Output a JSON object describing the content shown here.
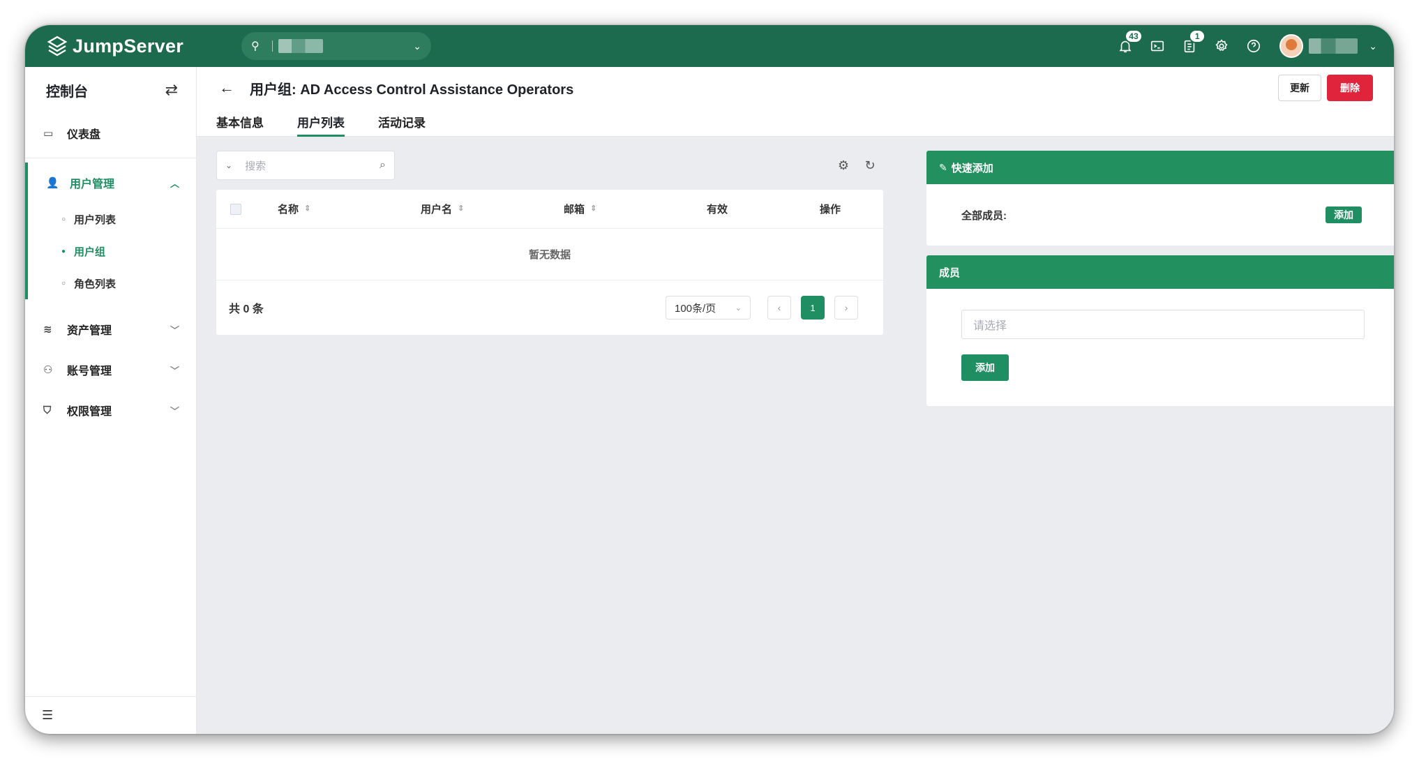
{
  "app": {
    "name": "JumpServer",
    "org_placeholder": ""
  },
  "topbar": {
    "notifications_count": "43",
    "tasks_count": "1"
  },
  "sidebar": {
    "title": "控制台",
    "items": [
      {
        "label": "仪表盘"
      },
      {
        "label": "用户管理",
        "sub": [
          "用户列表",
          "用户组",
          "角色列表"
        ]
      },
      {
        "label": "资产管理"
      },
      {
        "label": "账号管理"
      },
      {
        "label": "权限管理"
      }
    ]
  },
  "header": {
    "title": "用户组: AD Access Control Assistance Operators",
    "update_label": "更新",
    "delete_label": "删除",
    "tabs": [
      "基本信息",
      "用户列表",
      "活动记录"
    ]
  },
  "table": {
    "search_placeholder": "搜索",
    "columns": [
      "名称",
      "用户名",
      "邮箱",
      "有效",
      "操作"
    ],
    "empty_text": "暂无数据",
    "total_text": "共 0 条",
    "page_size": "100条/页",
    "current_page": "1"
  },
  "quick_add": {
    "title": "快速添加",
    "label": "全部成员:",
    "add_label": "添加"
  },
  "members": {
    "title": "成员",
    "placeholder": "请选择",
    "add_label": "添加"
  },
  "colors": {
    "brand": "#1d6b4f",
    "accent": "#1f8f63",
    "danger": "#e0243c"
  }
}
